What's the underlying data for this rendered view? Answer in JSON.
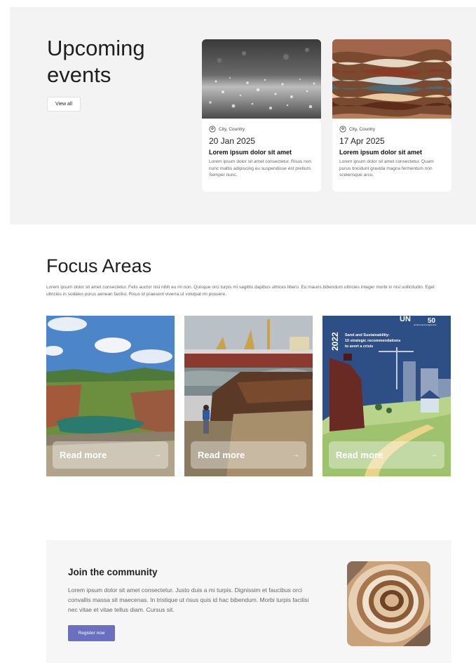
{
  "events": {
    "title": "Upcoming events",
    "view_all_label": "View all",
    "cards": [
      {
        "location": "City, Country",
        "date": "20 Jan 2025",
        "heading": "Lorem ipsum dolor sit amet",
        "description": "Lorem ipsum dolor sit amet consectetur. Risus non nunc mattis adipiscing eu suspendisse est pretium. Semper nunc."
      },
      {
        "location": "City, Country",
        "date": "17 Apr 2025",
        "heading": "Lorem ipsum dolor sit amet",
        "description": "Lorem ipsum dolor sit amet consectetur. Quam purus tincidunt gravida magna fermentum non scelerisque arcu."
      }
    ]
  },
  "focus": {
    "title": "Focus Areas",
    "description": "Lorem ipsum dolor sit amet consectetur. Felis auctor nisi nibh eu mi non. Quisque orci turpis mi sagittis dapibus ultrices libero. Eu mauris bibendum ultricies integer morbi in nisi sollicitudin. Eget ultricies in sodales purus aenean facilisi. Risus id praesent viverra ut volutpat mi posuere.",
    "cards": [
      {
        "read_more_label": "Read more"
      },
      {
        "read_more_label": "Read more"
      },
      {
        "read_more_label": "Read more",
        "poster_year": "2022",
        "poster_logo": "UN",
        "poster_program": "environment programme",
        "poster_badge": "50",
        "poster_title_line1": "Sand and Sustainability:",
        "poster_title_line2": "10 strategic recommendations",
        "poster_title_line3": "to avert a crisis"
      }
    ]
  },
  "join": {
    "title": "Join the community",
    "description": "Lorem ipsum dolor sit amet consectetur. Justo duis a mi turpis. Dignissim et faucibus orci convallis massa sit maecenas. In tristique ut risus quis id hac bibendum. Morbi turpis facilisi nec vitae et vitae tellus diam. Cursus sit.",
    "register_label": "Register now"
  },
  "colors": {
    "accent": "#6a6fc1",
    "section_bg": "#f3f3f3",
    "poster_blue": "#2e4e86"
  },
  "icons": {
    "location": "location-pin-icon",
    "arrow": "arrow-right-icon"
  }
}
